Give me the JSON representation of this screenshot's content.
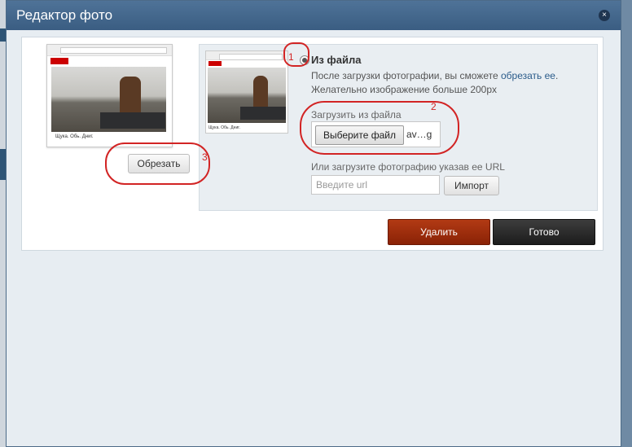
{
  "window": {
    "title": "Редактор фото",
    "close_icon": "×"
  },
  "preview": {
    "caption": "Щука. Обь. Дниг."
  },
  "crop_button": "Обрезать",
  "source": {
    "radio_label": "Из файла",
    "desc_before_link": "После загрузки фотографии, вы сможете ",
    "desc_link": "обрезать ее",
    "desc_after_link": ".",
    "desc_line2": "Желательно изображение больше 200px",
    "upload_label": "Загрузить из файла",
    "file_button": "Выберите файл",
    "file_name": "av…g",
    "url_label": "Или загрузите фотографию указав ее URL",
    "url_placeholder": "Введите url",
    "import_button": "Импорт"
  },
  "actions": {
    "delete": "Удалить",
    "done": "Готово"
  },
  "annotations": {
    "n1": "1",
    "n2": "2",
    "n3": "3",
    "color": "#d22424"
  },
  "colors": {
    "titlebar": "#4a6d91",
    "delete_button": "#a0300e",
    "done_button": "#2a2a2a"
  }
}
